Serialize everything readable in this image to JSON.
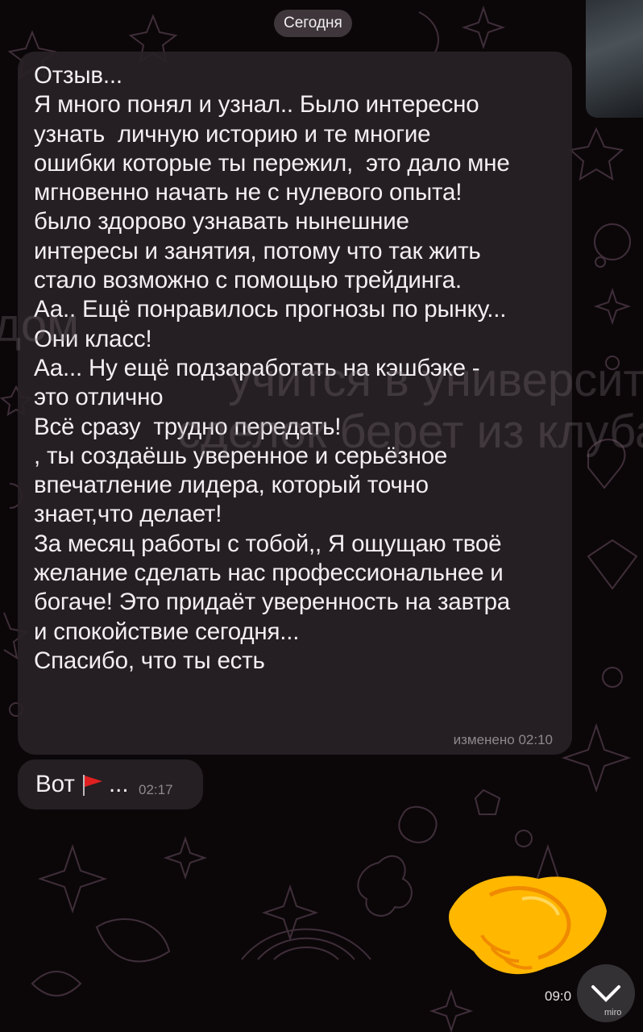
{
  "chat": {
    "date_label": "Сегодня",
    "message1": {
      "text": "Отзыв...\nЯ много понял и узнал.. Было интересно\nузнать  личную историю и те многие\nошибки которые ты пережил,  это дало мне\nмгновенно начать не с нулевого опыта!\nбыло здорово узнавать нынешние\nинтересы и занятия, потому что так жить\nстало возможно с помощью трейдинга.\nАа.. Ещё понравилось прогнозы по рынку...\nОни класс!\nАа... Ну ещё подзаработать на кэшбэке -\nэто отлично\nВсё сразу  трудно передать!\n, ты создаёшь уверенное и серьёзное\nвпечатление лидера, который точно\nзнает,что делает!\nЗа месяц работы с тобой,, Я ощущаю твоё\nжелание сделать нас профессиональнее и\nбогаче! Это придаёт уверенность на завтра\nи спокойствие сегодня...\nСпасибо, что ты есть",
      "meta": "изменено 02:10"
    },
    "message2": {
      "text": "Вот",
      "suffix": "...",
      "time": "02:17",
      "flag_icon": "red-flag-icon"
    },
    "message3": {
      "time": "09:0",
      "emoji_icon": "handshake-icon"
    },
    "watermark": "miro",
    "overlay_text": {
      "line1": "учится в университете, все с",
      "line2": "сделок берет из клуба. Заход",
      "left": "дом"
    },
    "scroll_icon": "chevron-down-icon"
  },
  "colors": {
    "background": "#0b0709",
    "bubble": "#282226",
    "pattern": "#5a3f4e",
    "flag": "#e02020",
    "handshake": "#ffb700"
  }
}
